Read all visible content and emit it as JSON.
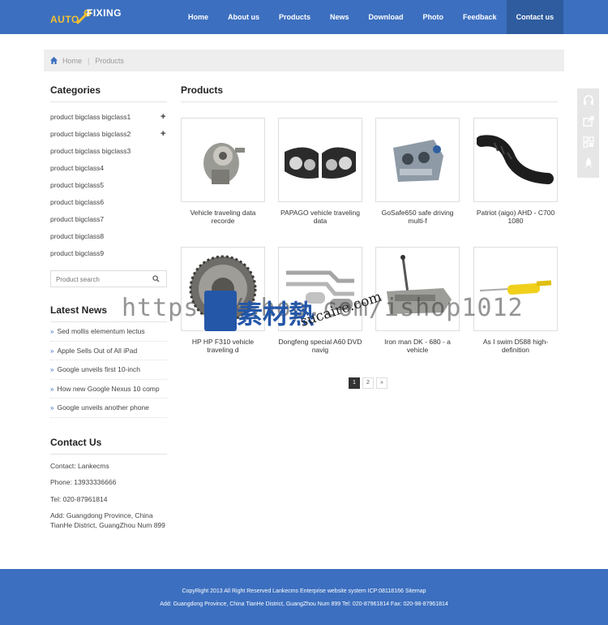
{
  "logo": {
    "word1": "AUTO",
    "word2": "FIXING",
    "icon": "wrench-icon"
  },
  "nav": [
    "Home",
    "About us",
    "Products",
    "News",
    "Download",
    "Photo",
    "Feedback",
    "Contact us"
  ],
  "breadcrumb": {
    "home": "Home",
    "sep": "|",
    "current": "Products"
  },
  "categories": {
    "title": "Categories",
    "items": [
      {
        "label": "product bigclass bigclass1",
        "expand": "+"
      },
      {
        "label": "product bigclass bigclass2",
        "expand": "+"
      },
      {
        "label": "product bigclass bigclass3",
        "expand": ""
      },
      {
        "label": "product bigclass4",
        "expand": ""
      },
      {
        "label": "product bigclass5",
        "expand": ""
      },
      {
        "label": "product bigclass6",
        "expand": ""
      },
      {
        "label": "product bigclass7",
        "expand": ""
      },
      {
        "label": "product bigclass8",
        "expand": ""
      },
      {
        "label": "product bigclass9",
        "expand": ""
      }
    ]
  },
  "search": {
    "placeholder": "Product search"
  },
  "latest_news": {
    "title": "Latest News",
    "items": [
      "Sed mollis elementum lectus",
      "Apple Sells Out of All iPad",
      "Google unveils first 10-inch",
      "How new Google Nexus 10 comp",
      "Google unveils another phone"
    ]
  },
  "contact": {
    "title": "Contact Us",
    "contact": "Contact: Lankecms",
    "phone": "Phone: 13933336666",
    "tel": "Tel: 020-87961814",
    "add": "Add: Guangdong Province, China TianHe District, GuangZhou Num 899"
  },
  "main": {
    "title": "Products",
    "products": [
      {
        "caption": "Vehicle traveling data recorde",
        "image": "engine-gearbox"
      },
      {
        "caption": "PAPAGO vehicle traveling data",
        "image": "headlights"
      },
      {
        "caption": "GoSafe650 safe driving multi-f",
        "image": "engine-block"
      },
      {
        "caption": "Patriot (aigo) AHD - C700 1080",
        "image": "rubber-hose"
      },
      {
        "caption": "HP HP F310 vehicle traveling d",
        "image": "clutch-gearbox"
      },
      {
        "caption": "Dongfeng special A60 DVD navig",
        "image": "exhaust-pipes"
      },
      {
        "caption": "Iron man DK - 680 - a vehicle",
        "image": "gearbox-shifter"
      },
      {
        "caption": "As I swim D588 high-definition",
        "image": "shock-absorber"
      }
    ]
  },
  "pager": [
    "1",
    "2",
    "»"
  ],
  "float_bar": [
    "headset-icon",
    "share-icon",
    "qrcode-icon",
    "rocket-icon"
  ],
  "watermark": {
    "url": "https://shop.com/ishop1012",
    "zh": "素材熱",
    "domain": "sucaire.com"
  },
  "footer": {
    "line1": "CopyRight 2013 All Right Reserved Lankecms Enterprise website system ICP:08118166 Sitemap",
    "line2": "Add: Guangdong Province, China TianHe District, GuangZhou Num 899  Tel: 020-87961814  Fax: 020-98-87961814"
  },
  "colors": {
    "brand_blue": "#3c6fbf",
    "nav_active": "#2e5c9e",
    "logo_yellow": "#f3c033"
  }
}
